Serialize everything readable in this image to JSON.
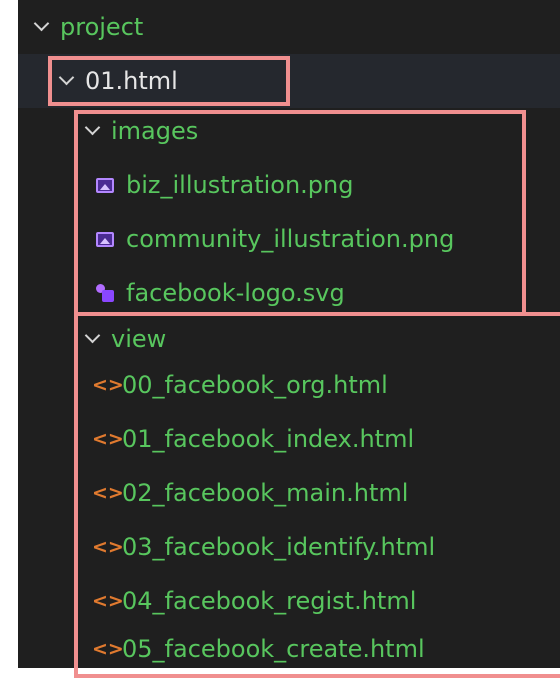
{
  "explorer": {
    "root": {
      "label": "project"
    },
    "folder_main": {
      "label": "01.html"
    },
    "folder_images": {
      "label": "images",
      "files": [
        {
          "name": "biz_illustration.png",
          "icon": "image-file-icon"
        },
        {
          "name": "community_illustration.png",
          "icon": "image-file-icon"
        },
        {
          "name": "facebook-logo.svg",
          "icon": "svg-file-icon"
        }
      ]
    },
    "folder_view": {
      "label": "view",
      "files": [
        {
          "name": "00_facebook_org.html",
          "icon": "html-file-icon"
        },
        {
          "name": "01_facebook_index.html",
          "icon": "html-file-icon"
        },
        {
          "name": "02_facebook_main.html",
          "icon": "html-file-icon"
        },
        {
          "name": "03_facebook_identify.html",
          "icon": "html-file-icon"
        },
        {
          "name": "04_facebook_regist.html",
          "icon": "html-file-icon"
        },
        {
          "name": "05_facebook_create.html",
          "icon": "html-file-icon"
        }
      ]
    }
  },
  "colors": {
    "panel_bg": "#1f1f1f",
    "selected_row_bg": "#25282e",
    "file_text": "#58c65e",
    "highlight_border": "#f08f8f",
    "html_icon": "#e07a2f",
    "image_icon": "#b387ff"
  }
}
